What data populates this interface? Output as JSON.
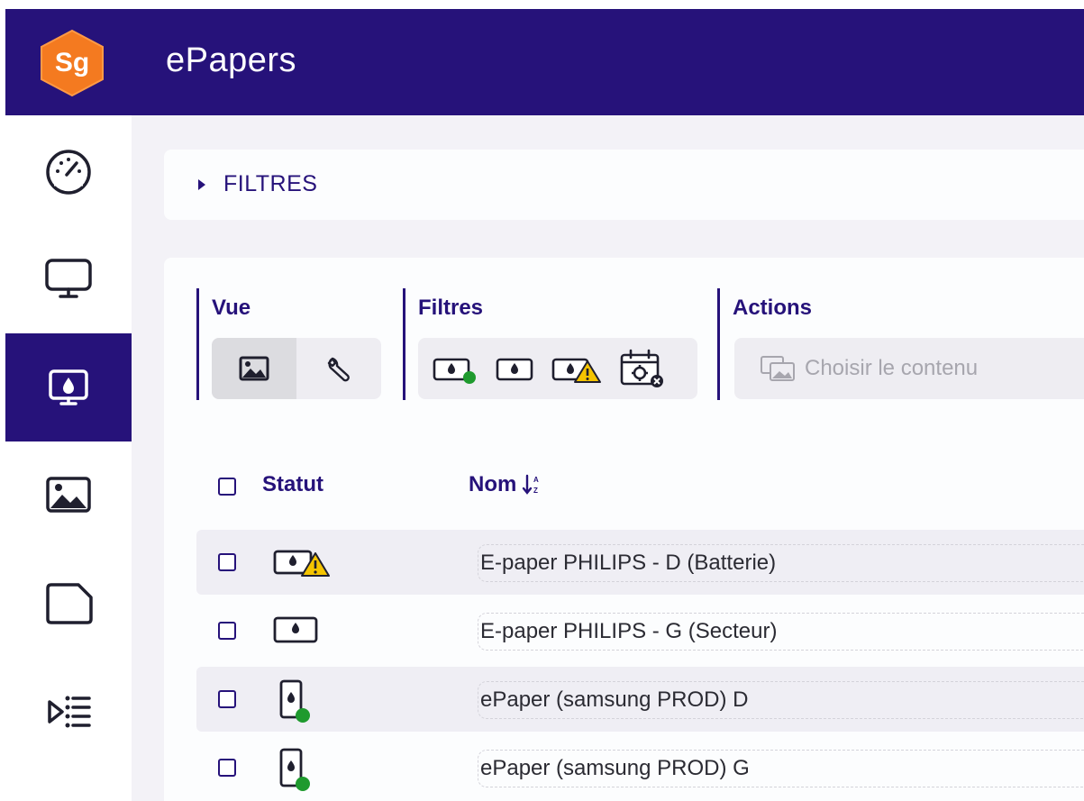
{
  "app": {
    "logo_text": "Sg",
    "title": "ePapers",
    "colors": {
      "primary": "#26127a",
      "logo_orange": "#f47a20",
      "status_ok": "#1f9a2e",
      "warning": "#f5c400"
    }
  },
  "sidebar": {
    "items": [
      {
        "icon": "dashboard-gauge-icon",
        "active": false
      },
      {
        "icon": "monitor-icon",
        "active": false
      },
      {
        "icon": "epaper-monitor-icon",
        "active": true
      },
      {
        "icon": "image-icon",
        "active": false
      },
      {
        "icon": "document-icon",
        "active": false
      },
      {
        "icon": "playlist-icon",
        "active": false
      }
    ]
  },
  "filters_panel": {
    "label": "FILTRES"
  },
  "toolbar": {
    "vue": {
      "label": "Vue",
      "options": [
        {
          "icon": "image-view-icon",
          "selected": true
        },
        {
          "icon": "wrench-icon",
          "selected": false
        }
      ]
    },
    "filtres": {
      "label": "Filtres",
      "options": [
        {
          "icon": "epaper-online-icon"
        },
        {
          "icon": "epaper-icon"
        },
        {
          "icon": "epaper-warning-icon"
        },
        {
          "icon": "calendar-settings-icon"
        }
      ]
    },
    "actions": {
      "label": "Actions",
      "placeholder": "Choisir le contenu",
      "icon": "content-images-icon"
    }
  },
  "table": {
    "columns": {
      "statut": "Statut",
      "nom": "Nom"
    },
    "rows": [
      {
        "name": "E-paper PHILIPS - D (Batterie)",
        "status": "warning-landscape",
        "shaded": true
      },
      {
        "name": "E-paper PHILIPS - G (Secteur)",
        "status": "normal-landscape",
        "shaded": false
      },
      {
        "name": "ePaper (samsung PROD) D",
        "status": "online-portrait",
        "shaded": true
      },
      {
        "name": "ePaper (samsung PROD) G",
        "status": "online-portrait",
        "shaded": false
      }
    ]
  }
}
